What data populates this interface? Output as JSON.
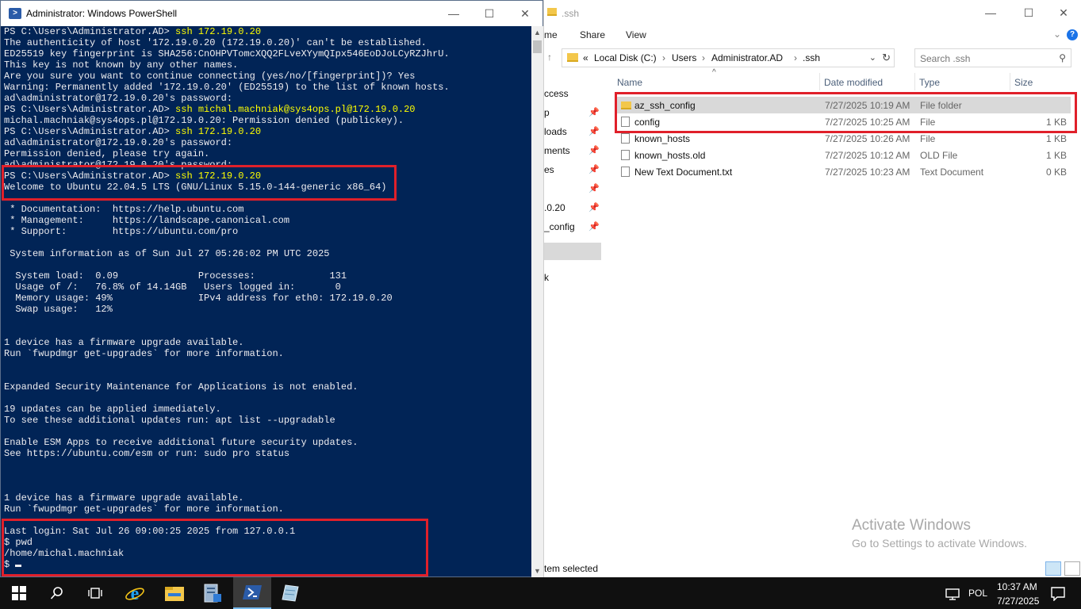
{
  "explorer": {
    "title": ".ssh",
    "window_controls": {
      "minimize": "—",
      "maximize": "☐",
      "close": "✕"
    },
    "ribbon_tabs": [
      "me",
      "Share",
      "View"
    ],
    "address": {
      "overflow": "«",
      "segments": [
        "Local Disk (C:)",
        "Users",
        "Administrator.AD",
        ".ssh"
      ],
      "separator": "›"
    },
    "search_placeholder": "Search .ssh",
    "nav_items": [
      {
        "label": "ccess",
        "pinned": false
      },
      {
        "label": "p",
        "pinned": true
      },
      {
        "label": "loads",
        "pinned": true
      },
      {
        "label": "ments",
        "pinned": true
      },
      {
        "label": "es",
        "pinned": true
      },
      {
        "label": "",
        "pinned": true
      },
      {
        "label": ".0.20",
        "pinned": true
      },
      {
        "label": "_config",
        "pinned": true
      },
      {
        "label": "",
        "pinned": false,
        "selected": true
      },
      {
        "label": "k",
        "pinned": false
      }
    ],
    "columns": {
      "name": "Name",
      "date": "Date modified",
      "type": "Type",
      "size": "Size"
    },
    "files": [
      {
        "name": "az_ssh_config",
        "date": "7/27/2025 10:19 AM",
        "type": "File folder",
        "size": "",
        "icon": "folder",
        "selected": true
      },
      {
        "name": "config",
        "date": "7/27/2025 10:25 AM",
        "type": "File",
        "size": "1 KB",
        "icon": "file"
      },
      {
        "name": "known_hosts",
        "date": "7/27/2025 10:26 AM",
        "type": "File",
        "size": "1 KB",
        "icon": "file"
      },
      {
        "name": "known_hosts.old",
        "date": "7/27/2025 10:12 AM",
        "type": "OLD File",
        "size": "1 KB",
        "icon": "file"
      },
      {
        "name": "New Text Document.txt",
        "date": "7/27/2025 10:23 AM",
        "type": "Text Document",
        "size": "0 KB",
        "icon": "file"
      }
    ],
    "status": "tem selected",
    "watermark": {
      "line1": "Activate Windows",
      "line2": "Go to Settings to activate Windows."
    }
  },
  "powershell": {
    "title": "Administrator: Windows PowerShell",
    "lines": [
      {
        "prefix": "PS C:\\Users\\Administrator.AD> ",
        "cmd": "ssh 172.19.0.20"
      },
      {
        "text": "The authenticity of host '172.19.0.20 (172.19.0.20)' can't be established."
      },
      {
        "text": "ED25519 key fingerprint is SHA256:CnOHPVTomcXQQ2FLveXYymQIpx546EoDJoLCyRZJhrU."
      },
      {
        "text": "This key is not known by any other names."
      },
      {
        "text": "Are you sure you want to continue connecting (yes/no/[fingerprint])? Yes"
      },
      {
        "text": "Warning: Permanently added '172.19.0.20' (ED25519) to the list of known hosts."
      },
      {
        "text": "ad\\administrator@172.19.0.20's password:"
      },
      {
        "prefix": "PS C:\\Users\\Administrator.AD> ",
        "cmd": "ssh michal.machniak@sys4ops.pl@172.19.0.20"
      },
      {
        "text": "michal.machniak@sys4ops.pl@172.19.0.20: Permission denied (publickey)."
      },
      {
        "prefix": "PS C:\\Users\\Administrator.AD> ",
        "cmd": "ssh 172.19.0.20"
      },
      {
        "text": "ad\\administrator@172.19.0.20's password:"
      },
      {
        "text": "Permission denied, please try again."
      },
      {
        "text": "ad\\administrator@172.19.0.20's password:"
      },
      {
        "prefix": "PS C:\\Users\\Administrator.AD> ",
        "cmd": "ssh 172.19.0.20"
      },
      {
        "text": "Welcome to Ubuntu 22.04.5 LTS (GNU/Linux 5.15.0-144-generic x86_64)"
      },
      {
        "text": ""
      },
      {
        "text": " * Documentation:  https://help.ubuntu.com"
      },
      {
        "text": " * Management:     https://landscape.canonical.com"
      },
      {
        "text": " * Support:        https://ubuntu.com/pro"
      },
      {
        "text": ""
      },
      {
        "text": " System information as of Sun Jul 27 05:26:02 PM UTC 2025"
      },
      {
        "text": ""
      },
      {
        "text": "  System load:  0.09              Processes:             131"
      },
      {
        "text": "  Usage of /:   76.8% of 14.14GB   Users logged in:       0"
      },
      {
        "text": "  Memory usage: 49%               IPv4 address for eth0: 172.19.0.20"
      },
      {
        "text": "  Swap usage:   12%"
      },
      {
        "text": ""
      },
      {
        "text": ""
      },
      {
        "text": "1 device has a firmware upgrade available."
      },
      {
        "text": "Run `fwupdmgr get-upgrades` for more information."
      },
      {
        "text": ""
      },
      {
        "text": ""
      },
      {
        "text": "Expanded Security Maintenance for Applications is not enabled."
      },
      {
        "text": ""
      },
      {
        "text": "19 updates can be applied immediately."
      },
      {
        "text": "To see these additional updates run: apt list --upgradable"
      },
      {
        "text": ""
      },
      {
        "text": "Enable ESM Apps to receive additional future security updates."
      },
      {
        "text": "See https://ubuntu.com/esm or run: sudo pro status"
      },
      {
        "text": ""
      },
      {
        "text": ""
      },
      {
        "text": ""
      },
      {
        "text": "1 device has a firmware upgrade available."
      },
      {
        "text": "Run `fwupdmgr get-upgrades` for more information."
      },
      {
        "text": ""
      },
      {
        "text": "Last login: Sat Jul 26 09:00:25 2025 from 127.0.0.1"
      },
      {
        "text": "$ pwd"
      },
      {
        "text": "/home/michal.machniak"
      },
      {
        "text": "$ ",
        "cursor": true
      }
    ]
  },
  "taskbar": {
    "items": [
      {
        "name": "start-icon",
        "glyph": "⊞"
      },
      {
        "name": "search-icon",
        "glyph": "⌕"
      },
      {
        "name": "task-view-icon",
        "glyph": "❐"
      },
      {
        "name": "internet-explorer-icon",
        "glyph": "e"
      },
      {
        "name": "file-explorer-icon",
        "glyph": ""
      },
      {
        "name": "server-manager-icon",
        "glyph": ""
      },
      {
        "name": "powershell-icon",
        "glyph": ">"
      },
      {
        "name": "app-icon",
        "glyph": ""
      }
    ],
    "language": "POL",
    "time": "10:37 AM",
    "date": "7/27/2025"
  },
  "colors": {
    "ps_bg": "#012456",
    "ps_cmd": "#ffff00",
    "highlight": "#e0202a"
  }
}
